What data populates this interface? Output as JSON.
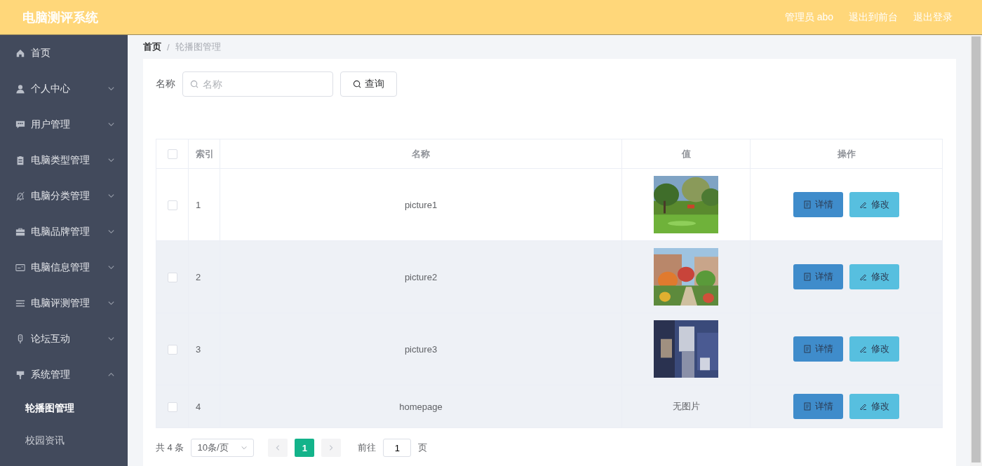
{
  "header": {
    "title": "电脑测评系统",
    "links": [
      "管理员 abo",
      "退出到前台",
      "退出登录"
    ]
  },
  "sidebar": {
    "items": [
      {
        "label": "首页",
        "expandable": false
      },
      {
        "label": "个人中心",
        "expandable": true,
        "expanded": false
      },
      {
        "label": "用户管理",
        "expandable": true,
        "expanded": false
      },
      {
        "label": "电脑类型管理",
        "expandable": true,
        "expanded": false
      },
      {
        "label": "电脑分类管理",
        "expandable": true,
        "expanded": false
      },
      {
        "label": "电脑品牌管理",
        "expandable": true,
        "expanded": false
      },
      {
        "label": "电脑信息管理",
        "expandable": true,
        "expanded": false
      },
      {
        "label": "电脑评测管理",
        "expandable": true,
        "expanded": false
      },
      {
        "label": "论坛互动",
        "expandable": true,
        "expanded": false
      },
      {
        "label": "系统管理",
        "expandable": true,
        "expanded": true,
        "children": [
          {
            "label": "轮播图管理",
            "selected": true
          },
          {
            "label": "校园资讯",
            "selected": false
          }
        ]
      }
    ]
  },
  "breadcrumb": [
    "首页",
    "/",
    "轮播图管理"
  ],
  "search": {
    "label": "名称",
    "placeholder": "名称",
    "button": "查询"
  },
  "table": {
    "all_checked": false,
    "columns": [
      "索引",
      "名称",
      "值",
      "操作"
    ],
    "rows": [
      {
        "checked": false,
        "index": "1",
        "name": "picture1",
        "value": {
          "kind": "picture"
        },
        "hovered": false,
        "actions": [
          "详情",
          "修改"
        ]
      },
      {
        "checked": false,
        "index": "2",
        "name": "picture2",
        "value": {
          "kind": "picture"
        },
        "hovered": true,
        "actions": [
          "详情",
          "修改"
        ]
      },
      {
        "checked": false,
        "index": "3",
        "name": "picture3",
        "value": {
          "kind": "picture"
        },
        "hovered": true,
        "actions": [
          "详情",
          "修改"
        ]
      },
      {
        "checked": false,
        "index": "4",
        "name": "homepage",
        "value": {
          "kind": "text",
          "text": "无图片"
        },
        "hovered": true,
        "actions": [
          "详情",
          "修改"
        ]
      }
    ]
  },
  "pagination": {
    "total": "共 4 条",
    "page_size": "10条/页",
    "pages": [
      {
        "label": "1",
        "selected": true
      }
    ],
    "goto_label": "前往",
    "goto_value": "1",
    "goto_unit": "页"
  }
}
